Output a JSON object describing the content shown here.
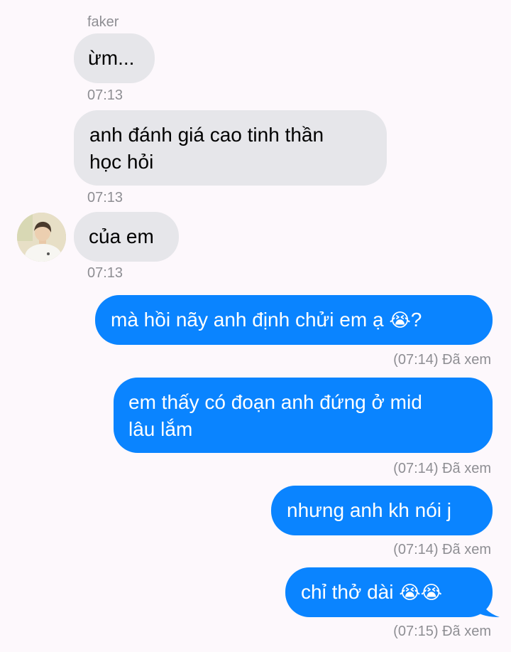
{
  "chat": {
    "sender_name": "faker",
    "messages": [
      {
        "direction": "incoming",
        "text": "ừm...",
        "time": "07:13"
      },
      {
        "direction": "incoming",
        "text": "anh đánh giá cao tinh thần học hỏi",
        "line1": "anh đánh giá cao tinh thần",
        "line2": "học hỏi",
        "time": "07:13"
      },
      {
        "direction": "incoming",
        "text": "của em",
        "time": "07:13"
      },
      {
        "direction": "outgoing",
        "text_before": "mà hồi nãy anh định chửi em ạ ",
        "emoji": "😭",
        "text_after": "?",
        "status": "(07:14) Đã xem"
      },
      {
        "direction": "outgoing",
        "line1": "em thấy có đoạn anh đứng ở mid",
        "line2": "lâu lắm",
        "status": "(07:14) Đã xem"
      },
      {
        "direction": "outgoing",
        "text": "nhưng anh kh nói j",
        "status": "(07:14) Đã xem"
      },
      {
        "direction": "outgoing",
        "text_before": "chỉ thở dài ",
        "emoji": "😭😭",
        "status": "(07:15) Đã xem"
      }
    ]
  },
  "colors": {
    "background": "#fdf8fc",
    "incoming_bubble": "#e6e6ea",
    "outgoing_bubble": "#0a84ff",
    "meta_text": "#8e8e93"
  },
  "icons": {
    "avatar": "contact-avatar-photo",
    "emoji": "loudly-crying-face"
  }
}
